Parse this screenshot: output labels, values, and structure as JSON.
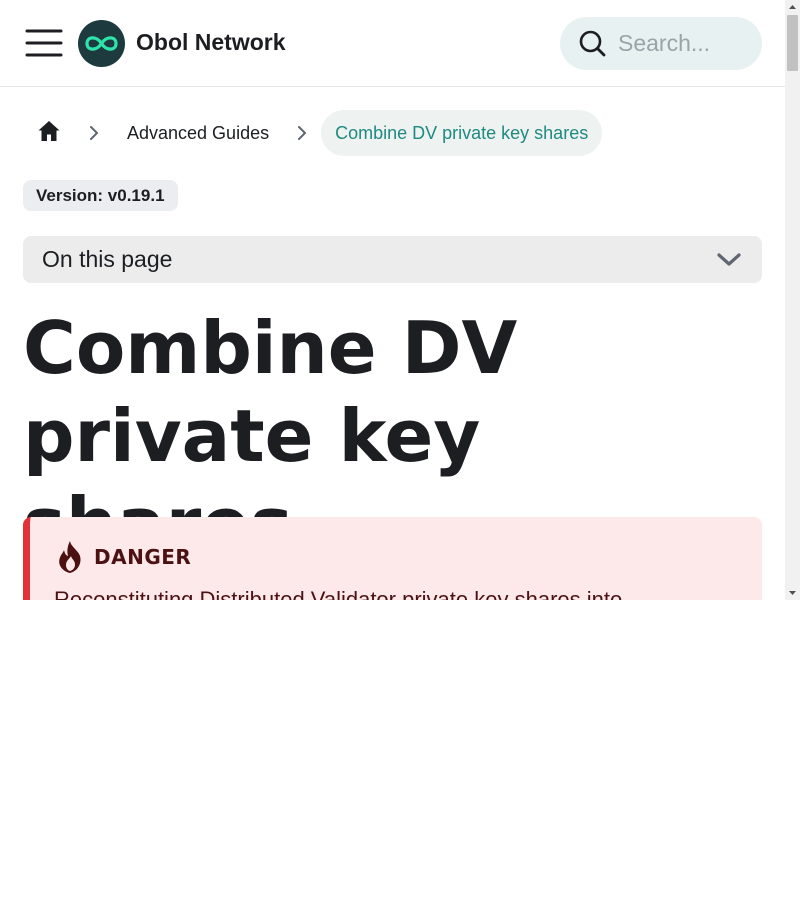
{
  "navbar": {
    "menu_icon": "hamburger-menu-icon",
    "logo_icon": "obol-infinity-logo",
    "brand": "Obol Network",
    "search": {
      "placeholder": "Search...",
      "value": "",
      "icon": "search-icon"
    }
  },
  "breadcrumb": {
    "home_icon": "home-icon",
    "separator_icon": "chevron-right-icon",
    "items": [
      {
        "label": "Advanced Guides"
      },
      {
        "label": "Combine DV private key shares",
        "active": true
      }
    ]
  },
  "version_badge": "Version: v0.19.1",
  "toc": {
    "label": "On this page",
    "icon": "chevron-down-icon"
  },
  "page_title": "Combine DV private key shares",
  "admonition": {
    "type": "danger",
    "icon": "fire-icon",
    "heading": "DANGER",
    "body": "Reconstituting Distributed Validator private key shares into"
  },
  "colors": {
    "accent": "#1f8a80",
    "danger_border": "#e13238",
    "danger_bg": "#fde8ea",
    "danger_text": "#4b1113",
    "logo_bg": "#1d3b3e",
    "logo_mark": "#2fe4ab",
    "search_bg": "#e8f1f1"
  }
}
